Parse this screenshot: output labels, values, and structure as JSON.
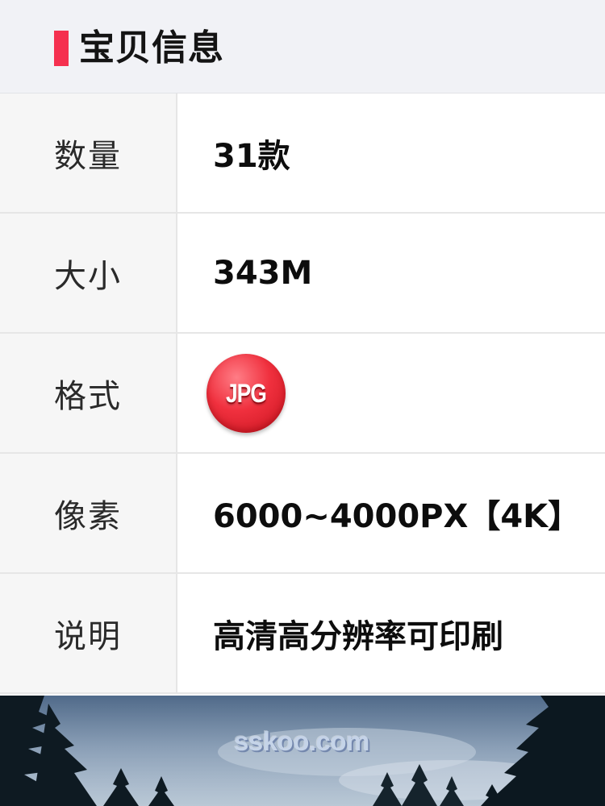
{
  "section": {
    "title": "宝贝信息"
  },
  "rows": [
    {
      "label": "数量",
      "value": "31款"
    },
    {
      "label": "大小",
      "value": "343M"
    },
    {
      "label": "格式",
      "value": "JPG"
    },
    {
      "label": "像素",
      "value": "6000~4000PX【4K】"
    },
    {
      "label": "说明",
      "value": "高清高分辨率可印刷"
    }
  ],
  "photo": {
    "watermark": "sskoo.com"
  },
  "colors": {
    "accent": "#f5304f",
    "label_bg": "#f6f6f6",
    "header_bg": "#f1f2f6"
  },
  "icons": {
    "format_badge": "jpg-badge-icon"
  }
}
